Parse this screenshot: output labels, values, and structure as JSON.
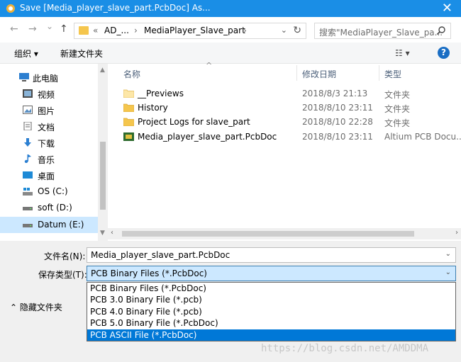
{
  "window": {
    "title": "Save [Media_player_slave_part.PcbDoc] As...",
    "close_glyph": "✕",
    "app_icon": "altium-icon"
  },
  "nav": {
    "back_glyph": "←",
    "forward_glyph": "→",
    "recent_glyph": "⌄",
    "up_glyph": "↑",
    "address": {
      "overflow": "«",
      "crumb1": "AD_...",
      "sep1": "›",
      "crumb2": "MediaPlayer_Slave_part",
      "sep2": "›",
      "dropdown_glyph": "⌄",
      "refresh_glyph": "↻"
    },
    "search": {
      "placeholder": "搜索\"MediaPlayer_Slave_pa..."
    }
  },
  "toolbar": {
    "organize": "组织 ▾",
    "new_folder": "新建文件夹",
    "view_glyph": "☷ ▾",
    "help": "?"
  },
  "sidebar": {
    "items": [
      {
        "label": "此电脑",
        "icon": "computer-icon"
      },
      {
        "label": "视频",
        "icon": "video-icon"
      },
      {
        "label": "图片",
        "icon": "pictures-icon"
      },
      {
        "label": "文档",
        "icon": "documents-icon"
      },
      {
        "label": "下载",
        "icon": "download-icon"
      },
      {
        "label": "音乐",
        "icon": "music-icon"
      },
      {
        "label": "桌面",
        "icon": "desktop-icon"
      },
      {
        "label": "OS (C:)",
        "icon": "windows-drive-icon"
      },
      {
        "label": "soft (D:)",
        "icon": "drive-icon"
      },
      {
        "label": "Datum (E:)",
        "icon": "drive-icon",
        "selected": true
      }
    ],
    "scroll_up": "▲",
    "scroll_down": "▼"
  },
  "files": {
    "headers": {
      "name": "名称",
      "date": "修改日期",
      "type": "类型",
      "sort_glyph": "^"
    },
    "rows": [
      {
        "name": "__Previews",
        "date": "2018/8/3 21:13",
        "type": "文件夹",
        "icon": "folder-icon"
      },
      {
        "name": "History",
        "date": "2018/8/10 23:11",
        "type": "文件夹",
        "icon": "folder-icon"
      },
      {
        "name": "Project Logs for slave_part",
        "date": "2018/8/10 22:28",
        "type": "文件夹",
        "icon": "folder-icon"
      },
      {
        "name": "Media_player_slave_part.PcbDoc",
        "date": "2018/8/10 23:11",
        "type": "Altium PCB Docu...",
        "icon": "pcb-file-icon"
      }
    ],
    "hscroll_left": "‹",
    "hscroll_right": "›"
  },
  "form": {
    "filename_label": "文件名(N):",
    "filename_value": "Media_player_slave_part.PcbDoc",
    "filetype_label": "保存类型(T):",
    "filetype_value": "PCB Binary Files (*.PcbDoc)",
    "dropdown_glyph": "⌄",
    "hide_folders": "⌃  隐藏文件夹"
  },
  "filetype_options": [
    "PCB Binary Files (*.PcbDoc)",
    "PCB 3.0 Binary File (*.pcb)",
    "PCB 4.0 Binary File (*.pcb)",
    "PCB 5.0 Binary File (*.PcbDoc)",
    "PCB ASCII File (*.PcbDoc)"
  ],
  "selected_option_index": 4,
  "watermark": "https://blog.csdn.net/AMDDMA",
  "colors": {
    "titlebar": "#1a8ee6",
    "selection": "#0078d7",
    "folder": "#f5c64d",
    "focus": "#cce8ff"
  }
}
